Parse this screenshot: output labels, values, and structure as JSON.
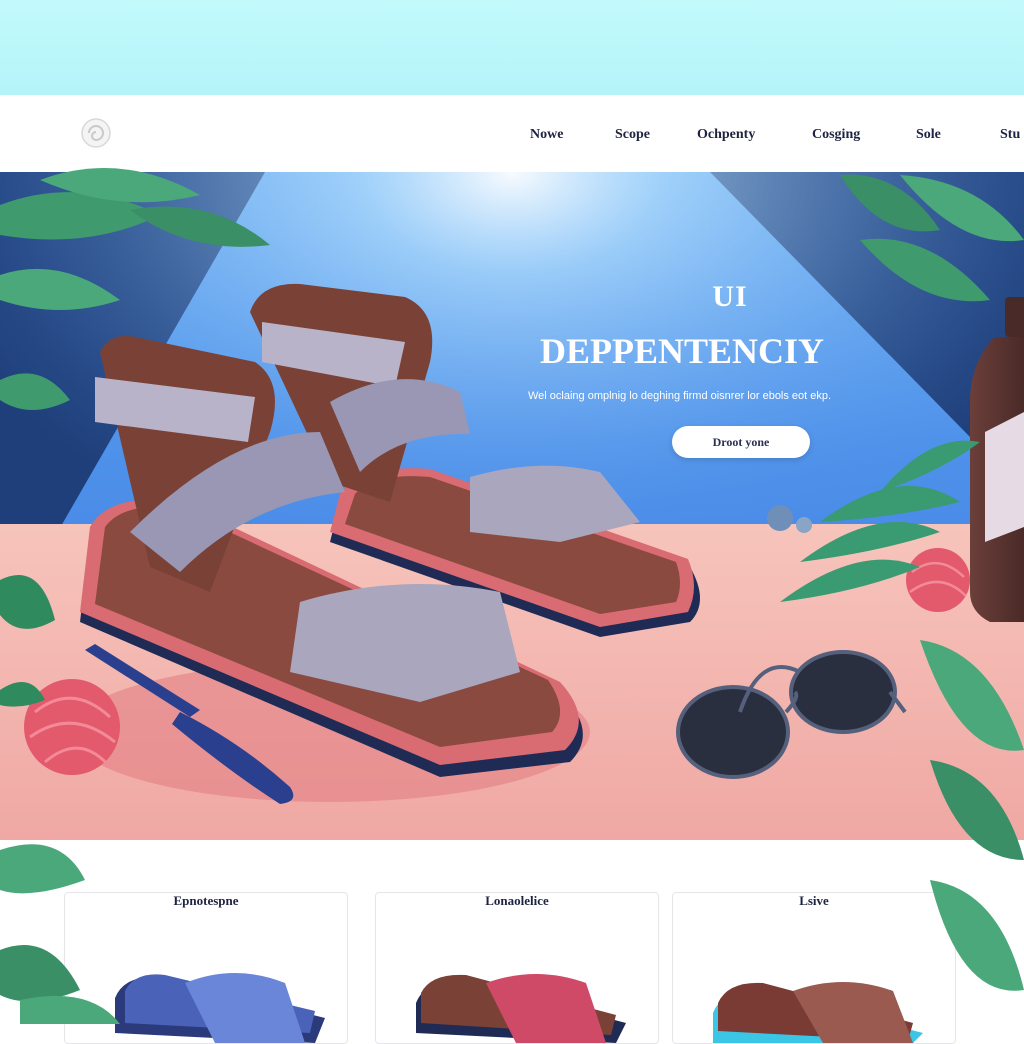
{
  "nav": {
    "logo_icon": "swirl-logo-icon",
    "items": [
      "Nowe",
      "Scope",
      "Ochpenty",
      "Cosging",
      "Sole",
      "Stu"
    ]
  },
  "hero": {
    "title_small": "UI",
    "title": "DEPPENTENCIY",
    "subtitle": "Wel oclaing omplnig lo deghing firmd oisnrer lor ebols eot ekp.",
    "cta_label": "Droot yone"
  },
  "products": {
    "cards": [
      {
        "label": "Epnotespne",
        "color": "#4a62b8"
      },
      {
        "label": "Lonaolelice",
        "color": "#cf4a66"
      },
      {
        "label": "Lsive",
        "color": "#7a3b35"
      }
    ]
  },
  "colors": {
    "sky_band": "#c2fafc",
    "hero_blue": "#4f92ea",
    "floor_pink": "#f0a8a4",
    "leaf_green": "#3a9a72",
    "sandal_brown": "#7a4237"
  }
}
